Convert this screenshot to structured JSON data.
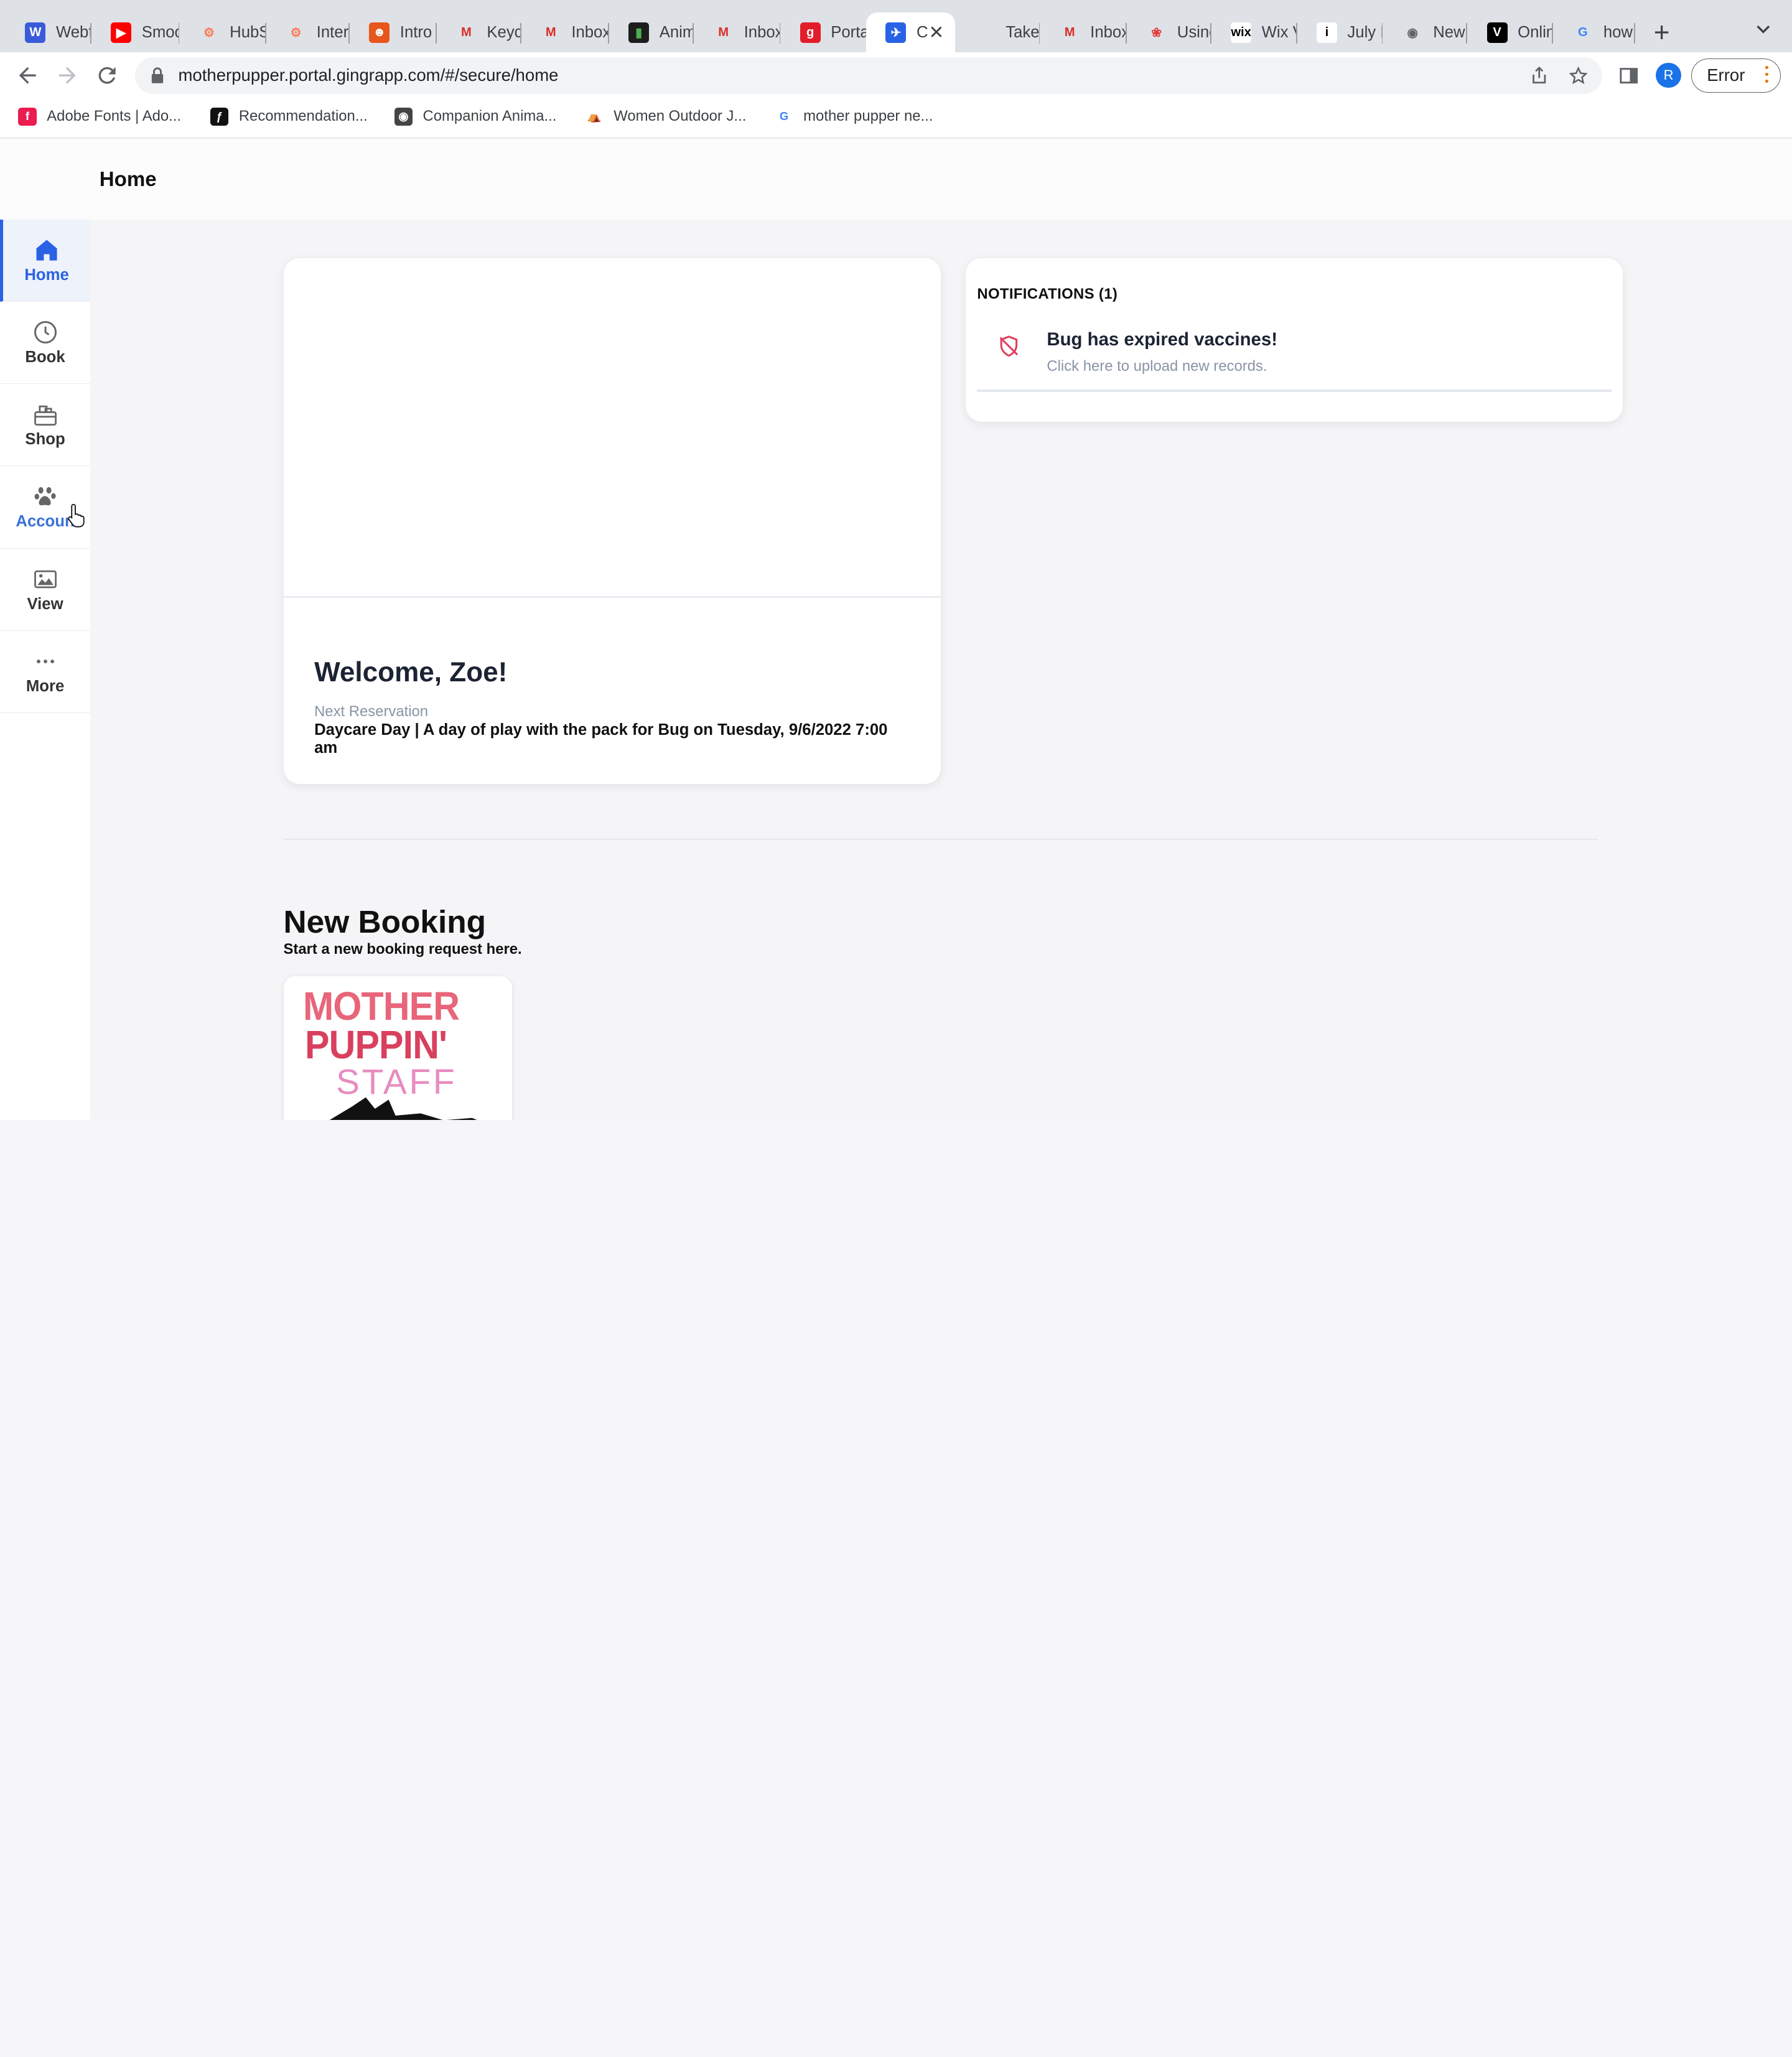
{
  "browser": {
    "tabs": [
      {
        "title": "Webf",
        "fav": "W",
        "bg": "#3a5bd9",
        "fg": "#fff"
      },
      {
        "title": "Smoo",
        "fav": "▶",
        "bg": "#ff0000",
        "fg": "#fff"
      },
      {
        "title": "HubS",
        "fav": "⚙",
        "bg": "transparent",
        "fg": "#ff7a59"
      },
      {
        "title": "Intera",
        "fav": "⚙",
        "bg": "transparent",
        "fg": "#ff7a59"
      },
      {
        "title": "Intro",
        "fav": "☻",
        "bg": "#e8561c",
        "fg": "#fff"
      },
      {
        "title": "Keyc",
        "fav": "M",
        "bg": "transparent",
        "fg": "#d93025"
      },
      {
        "title": "Inbox",
        "fav": "M",
        "bg": "transparent",
        "fg": "#d93025"
      },
      {
        "title": "Anim",
        "fav": "▮",
        "bg": "#1d1d1d",
        "fg": "#4caf50"
      },
      {
        "title": "Inbox",
        "fav": "M",
        "bg": "transparent",
        "fg": "#d93025"
      },
      {
        "title": "Porta",
        "fav": "g",
        "bg": "#e21c2a",
        "fg": "#fff"
      },
      {
        "title": "C",
        "fav": "✈",
        "bg": "#2a62e6",
        "fg": "#fff"
      },
      {
        "title": "Take",
        "fav": "",
        "bg": "transparent",
        "fg": "#555"
      },
      {
        "title": "Inbox",
        "fav": "M",
        "bg": "transparent",
        "fg": "#d93025"
      },
      {
        "title": "Using",
        "fav": "❀",
        "bg": "transparent",
        "fg": "#e23b3b"
      },
      {
        "title": "Wix V",
        "fav": "wix",
        "bg": "#fff",
        "fg": "#000"
      },
      {
        "title": "July I",
        "fav": "i",
        "bg": "#fff",
        "fg": "#000"
      },
      {
        "title": "New",
        "fav": "◉",
        "bg": "transparent",
        "fg": "#5f6368"
      },
      {
        "title": "Onlin",
        "fav": "V",
        "bg": "#000",
        "fg": "#fff"
      },
      {
        "title": "how",
        "fav": "G",
        "bg": "transparent",
        "fg": "#4285f4"
      }
    ],
    "url": "motherpupper.portal.gingrapp.com/#/secure/home",
    "profile_initial": "R",
    "error_label": "Error",
    "bookmarks": [
      {
        "label": "Adobe Fonts | Ado...",
        "fav": "f",
        "bg": "#eb1c50",
        "fg": "#fff"
      },
      {
        "label": "Recommendation...",
        "fav": "ƒ",
        "bg": "#111",
        "fg": "#fff"
      },
      {
        "label": "Companion Anima...",
        "fav": "◉",
        "bg": "#444",
        "fg": "#fff"
      },
      {
        "label": "Women Outdoor J...",
        "fav": "⛺",
        "bg": "transparent",
        "fg": "#c8852c"
      },
      {
        "label": "mother pupper ne...",
        "fav": "G",
        "bg": "transparent",
        "fg": "#4285f4"
      }
    ]
  },
  "app": {
    "page_title": "Home",
    "sidebar": [
      {
        "label": "Home",
        "icon": "home-icon"
      },
      {
        "label": "Book",
        "icon": "clock-icon"
      },
      {
        "label": "Shop",
        "icon": "shop-icon"
      },
      {
        "label": "Accoun",
        "icon": "paw-icon"
      },
      {
        "label": "View",
        "icon": "image-icon"
      },
      {
        "label": "More",
        "icon": "more-icon"
      }
    ],
    "welcome": {
      "title": "Welcome, Zoe!",
      "next_label": "Next Reservation",
      "next_detail": "Daycare Day | A day of play with the pack for Bug on Tuesday, 9/6/2022 7:00 am"
    },
    "notifications": {
      "header": "NOTIFICATIONS (1)",
      "items": [
        {
          "title": "Bug has expired vaccines!",
          "subtitle": "Click here to upload new records.",
          "icon": "shield-off-icon"
        }
      ]
    },
    "new_booking": {
      "title": "New Booking",
      "subtitle": "Start a new booking request here.",
      "logo_lines": [
        "MOTHER",
        "PUPPIN'",
        "STAFF"
      ]
    }
  },
  "colors": {
    "accent": "#2a62e6",
    "alert": "#e0405e"
  }
}
